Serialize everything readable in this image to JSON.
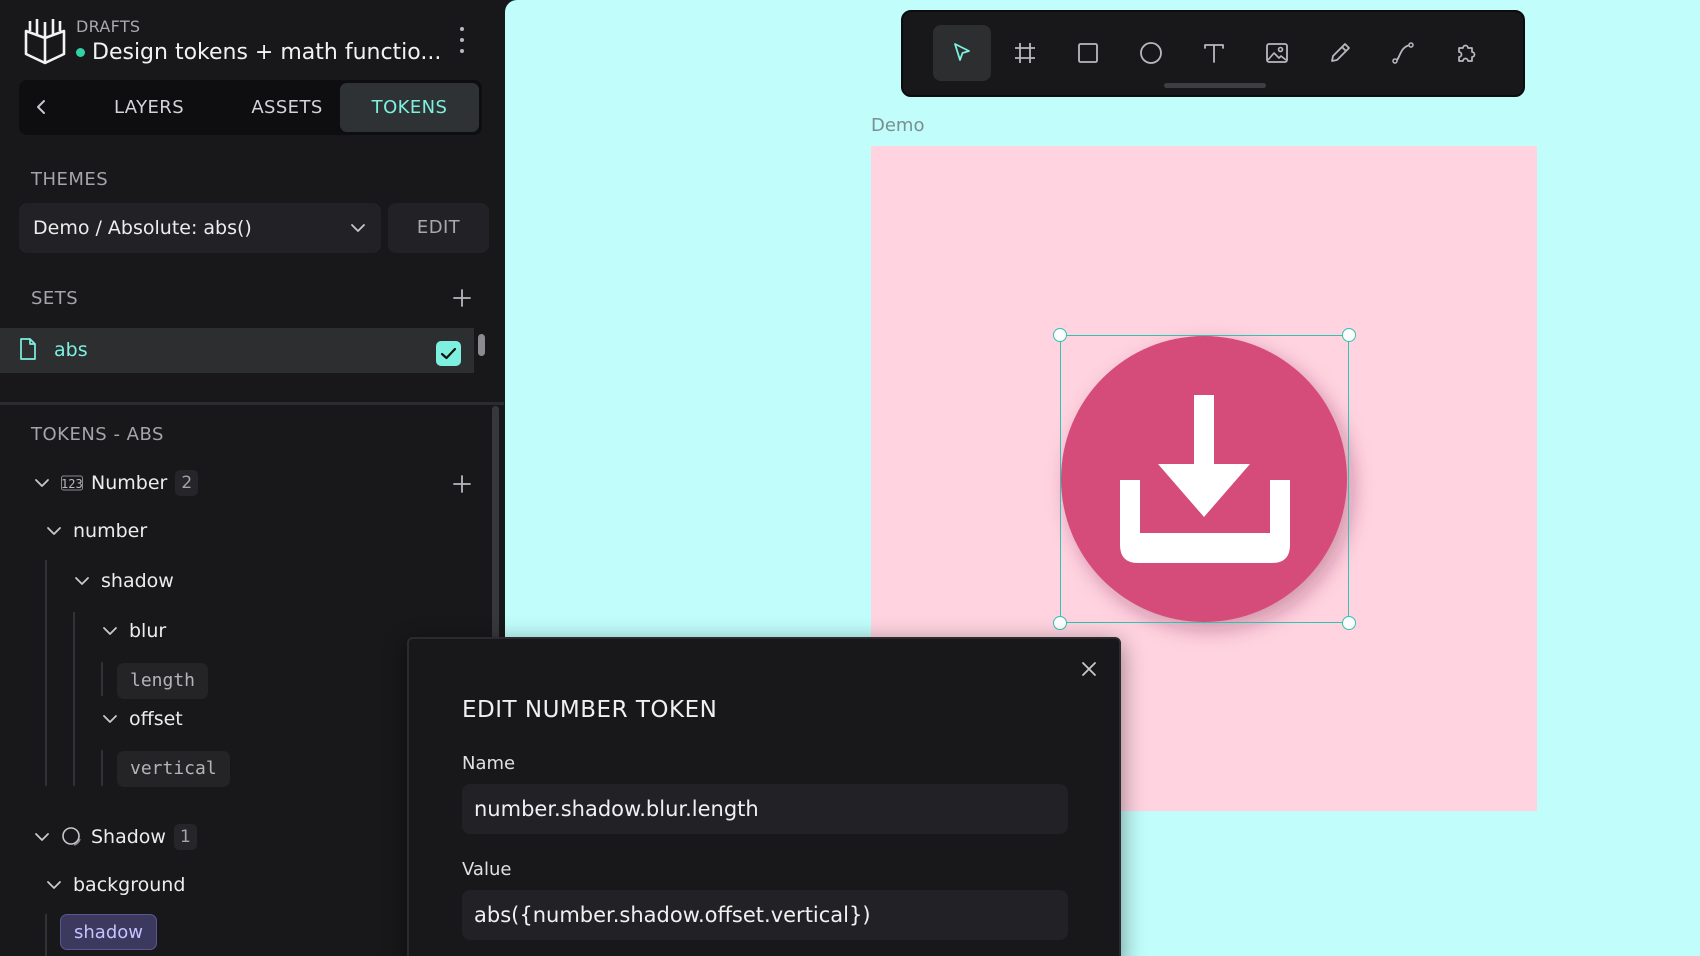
{
  "header": {
    "section": "DRAFTS",
    "file_title": "Design tokens + math functio..."
  },
  "tabs": [
    {
      "label": "LAYERS",
      "active": false
    },
    {
      "label": "ASSETS",
      "active": false
    },
    {
      "label": "TOKENS",
      "active": true
    }
  ],
  "themes": {
    "title": "THEMES",
    "selected": "Demo / Absolute: abs()",
    "edit_label": "EDIT"
  },
  "sets": {
    "title": "SETS",
    "items": [
      {
        "label": "abs",
        "checked": true
      }
    ]
  },
  "tokens": {
    "title": "TOKENS - ABS",
    "groups": [
      {
        "type_label": "Number",
        "count": "2",
        "nodes": {
          "root": "number",
          "child": "shadow",
          "blur": "blur",
          "blur_leaf": "length",
          "offset": "offset",
          "offset_leaf": "vertical"
        }
      },
      {
        "type_label": "Shadow",
        "count": "1",
        "nodes": {
          "root": "background",
          "leaf": "shadow"
        }
      }
    ]
  },
  "canvas": {
    "board_label": "Demo",
    "colors": {
      "background": "#c0fdfb",
      "board": "#ffd3e0",
      "shape": "#d54c79",
      "selection": "#31c3b0"
    }
  },
  "toolbar": {
    "tools": [
      "pointer-icon",
      "board-icon",
      "rectangle-icon",
      "ellipse-icon",
      "text-icon",
      "image-icon",
      "pencil-icon",
      "path-icon",
      "plugins-icon"
    ],
    "active_tool": "pointer-icon"
  },
  "dialog": {
    "title": "EDIT NUMBER TOKEN",
    "name_label": "Name",
    "name_value": "number.shadow.blur.length",
    "value_label": "Value",
    "value_value": "abs({number.shadow.offset.vertical})"
  },
  "colors": {
    "accent": "#7ef0e0",
    "sidebar_bg": "#18181a",
    "status_dot": "#31d0a6"
  }
}
